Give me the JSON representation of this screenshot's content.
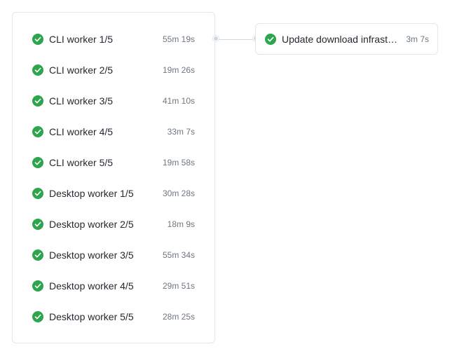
{
  "colors": {
    "success": "#2da44e",
    "text": "#24292f",
    "muted": "#6e7781",
    "border": "#e3e6ea"
  },
  "matrix_group": {
    "jobs": [
      {
        "name": "CLI worker 1/5",
        "duration": "55m 19s",
        "status": "success",
        "icon": "check-circle-icon"
      },
      {
        "name": "CLI worker 2/5",
        "duration": "19m 26s",
        "status": "success",
        "icon": "check-circle-icon"
      },
      {
        "name": "CLI worker 3/5",
        "duration": "41m 10s",
        "status": "success",
        "icon": "check-circle-icon"
      },
      {
        "name": "CLI worker 4/5",
        "duration": "33m 7s",
        "status": "success",
        "icon": "check-circle-icon"
      },
      {
        "name": "CLI worker 5/5",
        "duration": "19m 58s",
        "status": "success",
        "icon": "check-circle-icon"
      },
      {
        "name": "Desktop worker 1/5",
        "duration": "30m 28s",
        "status": "success",
        "icon": "check-circle-icon"
      },
      {
        "name": "Desktop worker 2/5",
        "duration": "18m 9s",
        "status": "success",
        "icon": "check-circle-icon"
      },
      {
        "name": "Desktop worker 3/5",
        "duration": "55m 34s",
        "status": "success",
        "icon": "check-circle-icon"
      },
      {
        "name": "Desktop worker 4/5",
        "duration": "29m 51s",
        "status": "success",
        "icon": "check-circle-icon"
      },
      {
        "name": "Desktop worker 5/5",
        "duration": "28m 25s",
        "status": "success",
        "icon": "check-circle-icon"
      }
    ]
  },
  "downstream_job": {
    "name": "Update download infrastr…",
    "duration": "3m 7s",
    "status": "success",
    "icon": "check-circle-icon"
  }
}
